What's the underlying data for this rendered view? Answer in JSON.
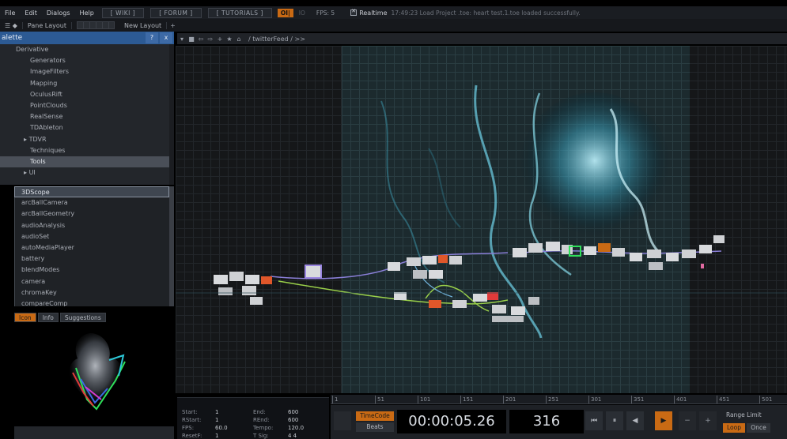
{
  "menu": {
    "items": [
      "File",
      "Edit",
      "Dialogs",
      "Help"
    ],
    "links": [
      "[ WIKI ]",
      "[ FORUM ]",
      "[ TUTORIALS ]"
    ],
    "oi_label": "OI|",
    "io_label": "IO",
    "fps_label": "FPS: 5",
    "realtime_label": "Realtime",
    "status_message": "17:49:23 Load Project .toe: heart test.1.toe loaded successfully."
  },
  "panebar": {
    "pane_layout_label": "Pane Layout",
    "new_layout_label": "New Layout",
    "add_label": "+"
  },
  "palette": {
    "title": "alette",
    "help_label": "?",
    "close_label": "x",
    "tree": [
      {
        "label": "Derivative",
        "level": "root"
      },
      {
        "label": "Generators",
        "level": "child"
      },
      {
        "label": "ImageFilters",
        "level": "child"
      },
      {
        "label": "Mapping",
        "level": "child"
      },
      {
        "label": "OculusRift",
        "level": "child"
      },
      {
        "label": "PointClouds",
        "level": "child"
      },
      {
        "label": "RealSense",
        "level": "child"
      },
      {
        "label": "TDAbleton",
        "level": "child"
      },
      {
        "label": "TDVR",
        "level": "exp"
      },
      {
        "label": "Techniques",
        "level": "child"
      },
      {
        "label": "Tools",
        "level": "child",
        "selected": true
      },
      {
        "label": "UI",
        "level": "exp"
      }
    ],
    "list": [
      "3DScope",
      "arcBallCamera",
      "arcBallGeometry",
      "audioAnalysis",
      "audioSet",
      "autoMediaPlayer",
      "battery",
      "blendModes",
      "camera",
      "chromaKey",
      "compareComp"
    ],
    "tabs": [
      "Icon",
      "Info",
      "Suggestions"
    ]
  },
  "network": {
    "path": "/ twitterFeed / >>"
  },
  "timeline": {
    "start_label": "Start:",
    "start_value": "1",
    "end_label": "End:",
    "end_value": "600",
    "rstart_label": "RStart:",
    "rstart_value": "1",
    "rend_label": "REnd:",
    "rend_value": "600",
    "fps_label": "FPS:",
    "fps_value": "60.0",
    "tempo_label": "Tempo:",
    "tempo_value": "120.0",
    "resetf_label": "ResetF:",
    "resetf_value": "1",
    "tsig_label": "T Sig:",
    "tsig_value": "4   4",
    "ruler_ticks": [
      "1",
      "51",
      "101",
      "151",
      "201",
      "251",
      "301",
      "351",
      "401",
      "451",
      "501"
    ],
    "timecode_label": "TimeCode",
    "beats_label": "Beats",
    "timecode_value": "00:00:05.26",
    "frame_value": "316",
    "range_limit_label": "Range Limit",
    "loop_label": "Loop",
    "once_label": "Once"
  }
}
